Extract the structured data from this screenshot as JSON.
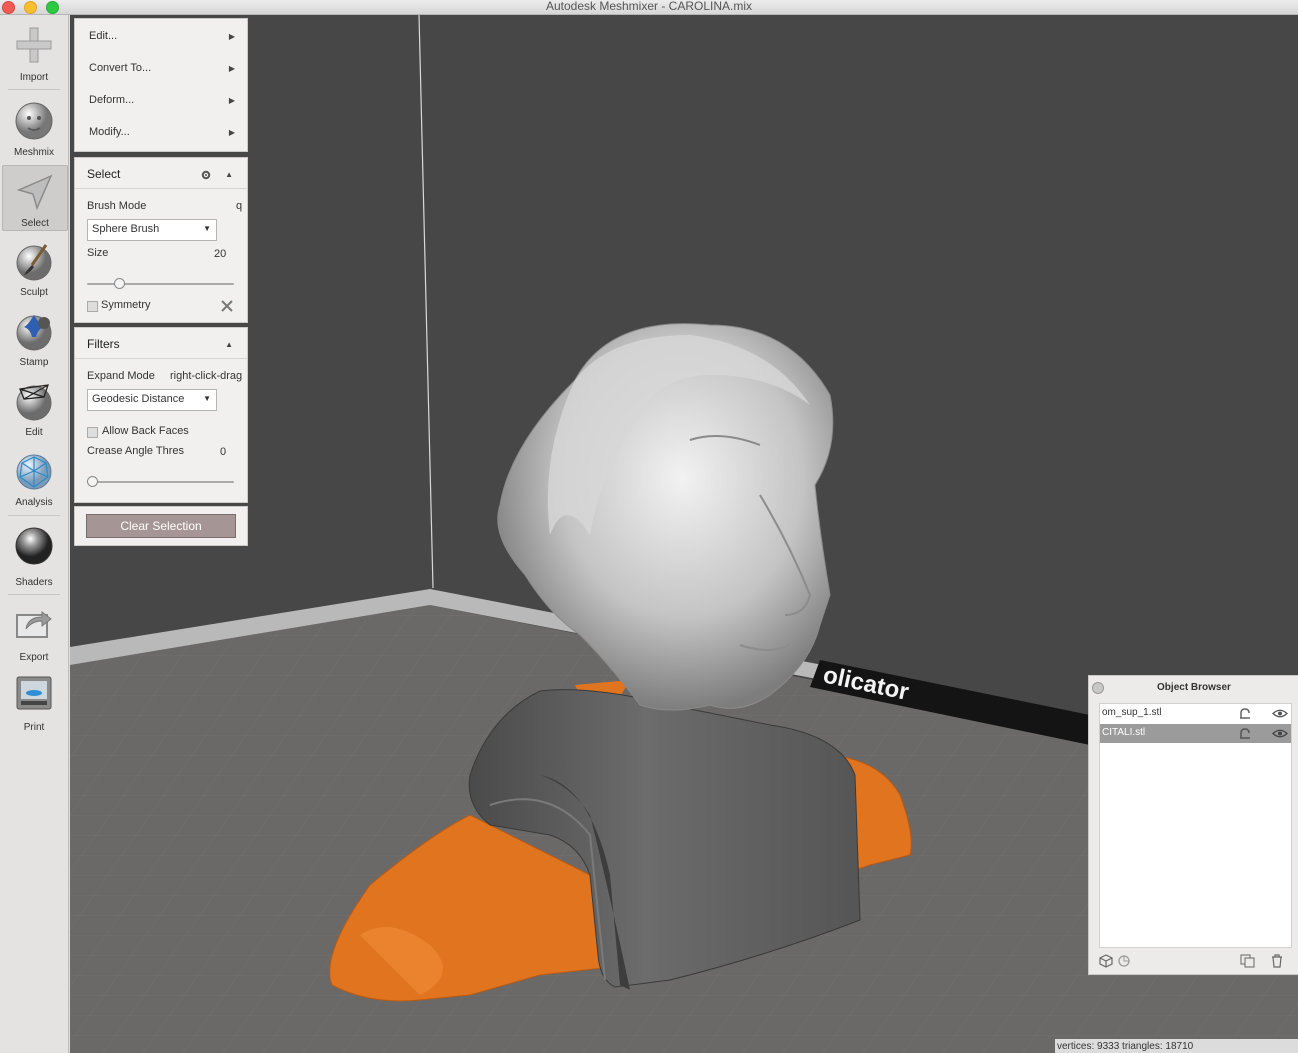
{
  "window": {
    "title": "Autodesk Meshmixer - CAROLINA.mix"
  },
  "toolbar": {
    "items": [
      {
        "label": "Import",
        "icon": "plus-icon"
      },
      {
        "label": "Meshmix",
        "icon": "face-sphere-icon"
      },
      {
        "label": "Select",
        "icon": "select-arrow-icon",
        "active": true
      },
      {
        "label": "Sculpt",
        "icon": "brush-sphere-icon"
      },
      {
        "label": "Stamp",
        "icon": "stamp-icon"
      },
      {
        "label": "Edit",
        "icon": "edit-mesh-icon"
      },
      {
        "label": "Analysis",
        "icon": "analysis-mesh-icon"
      },
      {
        "label": "Shaders",
        "icon": "chrome-sphere-icon"
      },
      {
        "label": "Export",
        "icon": "export-icon"
      },
      {
        "label": "Print",
        "icon": "printer-icon"
      }
    ]
  },
  "edit_menu": {
    "items": [
      {
        "label": "Edit..."
      },
      {
        "label": "Convert To..."
      },
      {
        "label": "Deform..."
      },
      {
        "label": "Modify..."
      }
    ]
  },
  "select_panel": {
    "title": "Select",
    "brush_mode_label": "Brush Mode",
    "brush_mode_hotkey": "q",
    "brush_mode_value": "Sphere Brush",
    "size_label": "Size",
    "size_value": "20",
    "size_fraction": 0.2,
    "symmetry_label": "Symmetry"
  },
  "filters_panel": {
    "title": "Filters",
    "expand_mode_label": "Expand Mode",
    "expand_mode_hint": "right-click-drag",
    "expand_mode_value": "Geodesic Distance",
    "allow_back_faces_label": "Allow Back Faces",
    "crease_angle_label": "Crease Angle Thres",
    "crease_angle_value": "0",
    "crease_angle_fraction": 0
  },
  "clear_selection": {
    "label": "Clear Selection"
  },
  "viewport": {
    "floor_text": "olicator"
  },
  "object_browser": {
    "title": "Object Browser",
    "objects": [
      {
        "name": "om_sup_1.stl",
        "selected": false
      },
      {
        "name": "CITALI.stl",
        "selected": true
      }
    ]
  },
  "status_bar": {
    "text": "vertices: 9333 triangles: 18710"
  },
  "colors": {
    "support_orange": "#e0741f",
    "viewport_bg": "#474747",
    "mesh_gray": "#5b5b5b"
  }
}
